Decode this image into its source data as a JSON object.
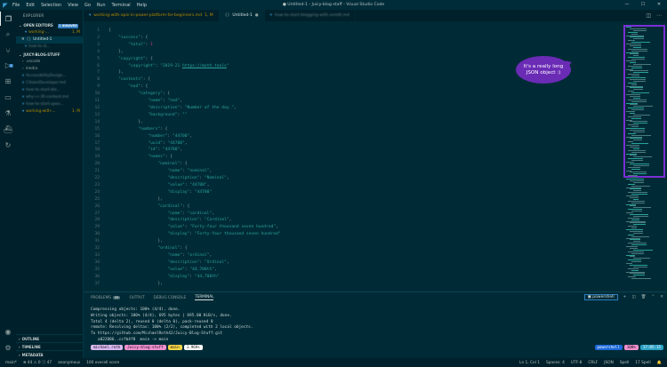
{
  "titlebar": {
    "menu": [
      "File",
      "Edit",
      "Selection",
      "View",
      "Go",
      "Run",
      "Terminal",
      "Help"
    ],
    "title": "● Untitled-1 - Juicy-blog-staff - Visual Studio Code"
  },
  "sidebar": {
    "header": "EXPLORER",
    "open_editors_label": "OPEN EDITORS",
    "unsaved_badge": "1 UNSAVED",
    "open_editors": [
      {
        "name": "working-...",
        "mark": "1, M"
      },
      {
        "name": "Untitled-1",
        "mark": ""
      },
      {
        "name": "how-to-st...",
        "mark": ""
      }
    ],
    "folder_label": "JUICY-BLOG-STUFF",
    "files": [
      {
        "name": ".vscode",
        "mark": ""
      },
      {
        "name": "media",
        "mark": ""
      },
      {
        "name": "AccessibilityDesign...",
        "mark": ""
      },
      {
        "name": "CitizenDeveloper.md",
        "mark": ""
      },
      {
        "name": "how-to-start-blo...",
        "mark": ""
      },
      {
        "name": "why-i-r-30-content.md",
        "mark": ""
      },
      {
        "name": "how-to-start-spea...",
        "mark": ""
      },
      {
        "name": "working-with-...",
        "mark": "1, M"
      }
    ],
    "bottom_sections": [
      "OUTLINE",
      "TIMELINE",
      "METADATA"
    ]
  },
  "tabs": [
    {
      "label": "working-with-apis-in-power-platform-for-beginners.md",
      "mark": "1, M",
      "active": false
    },
    {
      "label": "Untitled-1",
      "mark": "●",
      "active": true
    },
    {
      "label": "how-to-start-blogging-with-sendit.md",
      "mark": "1",
      "active": false
    }
  ],
  "editor": {
    "gutter": [
      "1",
      "2",
      "3",
      "4",
      "5",
      "6",
      "7",
      "8",
      "9",
      "10",
      "11",
      "12",
      "13",
      "14",
      "15",
      "16",
      "17",
      "18",
      "19",
      "20",
      "21",
      "22",
      "23",
      "24",
      "25",
      "26",
      "27",
      "28",
      "29",
      "30",
      "31",
      "32",
      "33",
      "34",
      "35",
      "36",
      "37"
    ]
  },
  "callout": {
    "line1": "It's a really long",
    "line2": "JSON object :)"
  },
  "panel": {
    "tabs": [
      "PROBLEMS",
      "OUTPUT",
      "DEBUG CONSOLE",
      "TERMINAL"
    ],
    "problems_count": "99",
    "shell_label": "powershell",
    "terminal_lines": [
      "Compressing objects: 100% (4/4), done.",
      "Writing objects: 100% (4/4), 695 bytes | 695.00 KiB/s, done.",
      "Total 4 (delta 2), reused 0 (delta 0), pack-reused 0",
      "remote: Resolving deltas: 100% (2/2), completed with 2 local objects.",
      "To https://github.com/MichaelRoth42/Juicy-Blog-Stuff.git",
      "   a022886..ccfb4f8  main -> main"
    ],
    "prompt": {
      "user": "michael.roth",
      "repo": "Juicy-blog-stuff",
      "branch": "main",
      "time": "1.969s"
    },
    "right_prompt": {
      "shell": "powershell",
      "battery": "100%",
      "clock": "17:05:15"
    }
  },
  "statusbar": {
    "left": [
      "main*",
      "⊗ 44 ⚠ 0 ⓘ 47",
      "anonymous",
      "100 overall score"
    ],
    "right": [
      "Ln 1, Col 1",
      "Spaces: 4",
      "UTF-8",
      "CRLF",
      "JSON",
      "Spell",
      "17 Spell"
    ]
  },
  "colors": {
    "accent_purple": "#7b2fd4",
    "callout_bg": "#6a2bb5",
    "editor_bg": "#002b36",
    "string": "#2aa198",
    "number": "#d33682"
  }
}
